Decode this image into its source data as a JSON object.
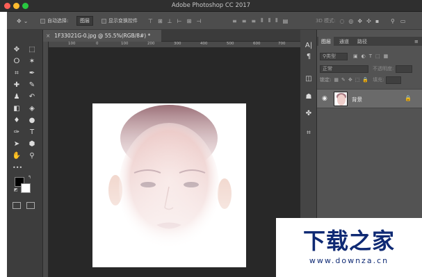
{
  "window": {
    "title": "Adobe Photoshop CC 2017",
    "traffic_lights": {
      "close": "#ff5f57",
      "minimize": "#febc2e",
      "zoom": "#28c840"
    }
  },
  "options_bar": {
    "move_tool_glyph": "✥",
    "auto_select_label": "自动选择:",
    "auto_select_value": "图层",
    "show_transform_label": "显示变换控件",
    "mode_3d_label": "3D 模式:"
  },
  "document": {
    "tab_title": "1F33021G-0.jpg @ 55.5%(RGB/8#) *",
    "ruler_labels": [
      "100",
      "0",
      "100",
      "200",
      "300",
      "400",
      "500",
      "600",
      "700"
    ]
  },
  "tools": [
    {
      "name": "move-tool",
      "glyph": "✥"
    },
    {
      "name": "marquee-tool",
      "glyph": "⬚"
    },
    {
      "name": "lasso-tool",
      "glyph": "ⵔ"
    },
    {
      "name": "magic-wand-tool",
      "glyph": "✶"
    },
    {
      "name": "crop-tool",
      "glyph": "⌗"
    },
    {
      "name": "eyedropper-tool",
      "glyph": "✒"
    },
    {
      "name": "healing-brush-tool",
      "glyph": "✚"
    },
    {
      "name": "brush-tool",
      "glyph": "✎"
    },
    {
      "name": "clone-stamp-tool",
      "glyph": "♟"
    },
    {
      "name": "history-brush-tool",
      "glyph": "↶"
    },
    {
      "name": "eraser-tool",
      "glyph": "◧"
    },
    {
      "name": "paint-bucket-tool",
      "glyph": "◈"
    },
    {
      "name": "blur-tool",
      "glyph": "♦"
    },
    {
      "name": "dodge-tool",
      "glyph": "●"
    },
    {
      "name": "pen-tool",
      "glyph": "✑"
    },
    {
      "name": "type-tool",
      "glyph": "T"
    },
    {
      "name": "path-selection-tool",
      "glyph": "➤"
    },
    {
      "name": "shape-tool",
      "glyph": "⬢"
    },
    {
      "name": "hand-tool",
      "glyph": "✋"
    },
    {
      "name": "zoom-tool",
      "glyph": "⚲"
    }
  ],
  "more_tools_glyph": "•••",
  "colors": {
    "foreground": "#000000",
    "background": "#ffffff"
  },
  "strip_tools": [
    {
      "name": "character-panel",
      "glyph": "A|"
    },
    {
      "name": "paragraph-panel",
      "glyph": "¶"
    },
    {
      "name": "layers-panel",
      "glyph": "◫"
    },
    {
      "name": "channels-panel",
      "glyph": "☗"
    },
    {
      "name": "shapes-panel",
      "glyph": "✤"
    },
    {
      "name": "crop-panel",
      "glyph": "⌗"
    }
  ],
  "layers_panel": {
    "tabs": [
      "图层",
      "通道",
      "路径"
    ],
    "filter_label": "类型",
    "blend_mode": "正常",
    "opacity_label": "不透明度:",
    "lock_label": "锁定:",
    "fill_label": "填充:",
    "layer": {
      "name": "背景",
      "visible": true
    }
  },
  "watermark": {
    "title": "下载之家",
    "url": "www.downza.cn"
  }
}
